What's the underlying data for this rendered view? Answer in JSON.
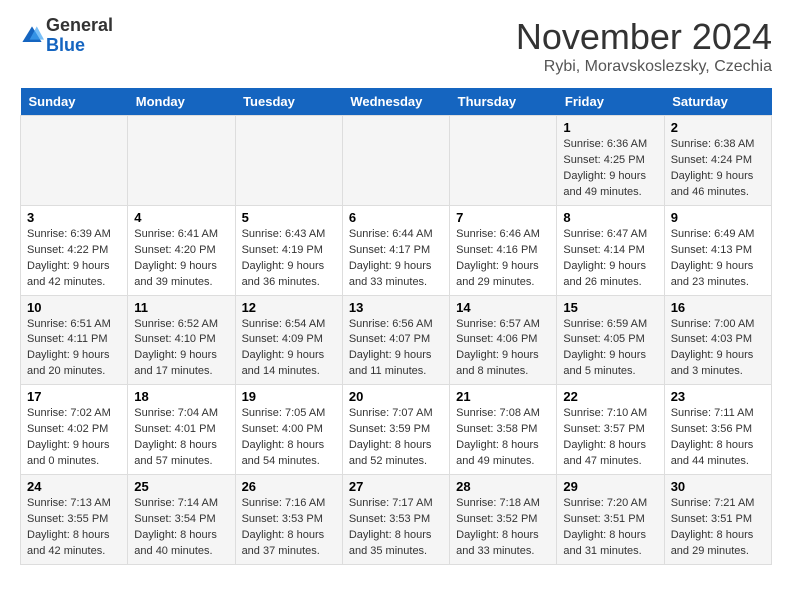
{
  "header": {
    "logo_general": "General",
    "logo_blue": "Blue",
    "month_title": "November 2024",
    "location": "Rybi, Moravskoslezsky, Czechia"
  },
  "weekdays": [
    "Sunday",
    "Monday",
    "Tuesday",
    "Wednesday",
    "Thursday",
    "Friday",
    "Saturday"
  ],
  "weeks": [
    [
      {
        "day": "",
        "info": ""
      },
      {
        "day": "",
        "info": ""
      },
      {
        "day": "",
        "info": ""
      },
      {
        "day": "",
        "info": ""
      },
      {
        "day": "",
        "info": ""
      },
      {
        "day": "1",
        "info": "Sunrise: 6:36 AM\nSunset: 4:25 PM\nDaylight: 9 hours and 49 minutes."
      },
      {
        "day": "2",
        "info": "Sunrise: 6:38 AM\nSunset: 4:24 PM\nDaylight: 9 hours and 46 minutes."
      }
    ],
    [
      {
        "day": "3",
        "info": "Sunrise: 6:39 AM\nSunset: 4:22 PM\nDaylight: 9 hours and 42 minutes."
      },
      {
        "day": "4",
        "info": "Sunrise: 6:41 AM\nSunset: 4:20 PM\nDaylight: 9 hours and 39 minutes."
      },
      {
        "day": "5",
        "info": "Sunrise: 6:43 AM\nSunset: 4:19 PM\nDaylight: 9 hours and 36 minutes."
      },
      {
        "day": "6",
        "info": "Sunrise: 6:44 AM\nSunset: 4:17 PM\nDaylight: 9 hours and 33 minutes."
      },
      {
        "day": "7",
        "info": "Sunrise: 6:46 AM\nSunset: 4:16 PM\nDaylight: 9 hours and 29 minutes."
      },
      {
        "day": "8",
        "info": "Sunrise: 6:47 AM\nSunset: 4:14 PM\nDaylight: 9 hours and 26 minutes."
      },
      {
        "day": "9",
        "info": "Sunrise: 6:49 AM\nSunset: 4:13 PM\nDaylight: 9 hours and 23 minutes."
      }
    ],
    [
      {
        "day": "10",
        "info": "Sunrise: 6:51 AM\nSunset: 4:11 PM\nDaylight: 9 hours and 20 minutes."
      },
      {
        "day": "11",
        "info": "Sunrise: 6:52 AM\nSunset: 4:10 PM\nDaylight: 9 hours and 17 minutes."
      },
      {
        "day": "12",
        "info": "Sunrise: 6:54 AM\nSunset: 4:09 PM\nDaylight: 9 hours and 14 minutes."
      },
      {
        "day": "13",
        "info": "Sunrise: 6:56 AM\nSunset: 4:07 PM\nDaylight: 9 hours and 11 minutes."
      },
      {
        "day": "14",
        "info": "Sunrise: 6:57 AM\nSunset: 4:06 PM\nDaylight: 9 hours and 8 minutes."
      },
      {
        "day": "15",
        "info": "Sunrise: 6:59 AM\nSunset: 4:05 PM\nDaylight: 9 hours and 5 minutes."
      },
      {
        "day": "16",
        "info": "Sunrise: 7:00 AM\nSunset: 4:03 PM\nDaylight: 9 hours and 3 minutes."
      }
    ],
    [
      {
        "day": "17",
        "info": "Sunrise: 7:02 AM\nSunset: 4:02 PM\nDaylight: 9 hours and 0 minutes."
      },
      {
        "day": "18",
        "info": "Sunrise: 7:04 AM\nSunset: 4:01 PM\nDaylight: 8 hours and 57 minutes."
      },
      {
        "day": "19",
        "info": "Sunrise: 7:05 AM\nSunset: 4:00 PM\nDaylight: 8 hours and 54 minutes."
      },
      {
        "day": "20",
        "info": "Sunrise: 7:07 AM\nSunset: 3:59 PM\nDaylight: 8 hours and 52 minutes."
      },
      {
        "day": "21",
        "info": "Sunrise: 7:08 AM\nSunset: 3:58 PM\nDaylight: 8 hours and 49 minutes."
      },
      {
        "day": "22",
        "info": "Sunrise: 7:10 AM\nSunset: 3:57 PM\nDaylight: 8 hours and 47 minutes."
      },
      {
        "day": "23",
        "info": "Sunrise: 7:11 AM\nSunset: 3:56 PM\nDaylight: 8 hours and 44 minutes."
      }
    ],
    [
      {
        "day": "24",
        "info": "Sunrise: 7:13 AM\nSunset: 3:55 PM\nDaylight: 8 hours and 42 minutes."
      },
      {
        "day": "25",
        "info": "Sunrise: 7:14 AM\nSunset: 3:54 PM\nDaylight: 8 hours and 40 minutes."
      },
      {
        "day": "26",
        "info": "Sunrise: 7:16 AM\nSunset: 3:53 PM\nDaylight: 8 hours and 37 minutes."
      },
      {
        "day": "27",
        "info": "Sunrise: 7:17 AM\nSunset: 3:53 PM\nDaylight: 8 hours and 35 minutes."
      },
      {
        "day": "28",
        "info": "Sunrise: 7:18 AM\nSunset: 3:52 PM\nDaylight: 8 hours and 33 minutes."
      },
      {
        "day": "29",
        "info": "Sunrise: 7:20 AM\nSunset: 3:51 PM\nDaylight: 8 hours and 31 minutes."
      },
      {
        "day": "30",
        "info": "Sunrise: 7:21 AM\nSunset: 3:51 PM\nDaylight: 8 hours and 29 minutes."
      }
    ]
  ]
}
